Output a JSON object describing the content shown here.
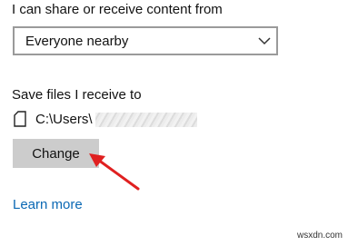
{
  "share": {
    "label": "I can share or receive content from",
    "selected_option": "Everyone nearby"
  },
  "save": {
    "label": "Save files I receive to",
    "path_prefix": "C:\\Users\\"
  },
  "buttons": {
    "change_label": "Change"
  },
  "links": {
    "learn_more": "Learn more"
  },
  "watermark": "wsxdn.com",
  "colors": {
    "link": "#0a68b4",
    "button_bg": "#cccccc",
    "arrow": "#e02020",
    "dropdown_border": "#9a9a9a"
  },
  "icons": {
    "dropdown": "chevron-down-icon",
    "folder_path": "file-icon",
    "annotation": "red-arrow-icon"
  }
}
